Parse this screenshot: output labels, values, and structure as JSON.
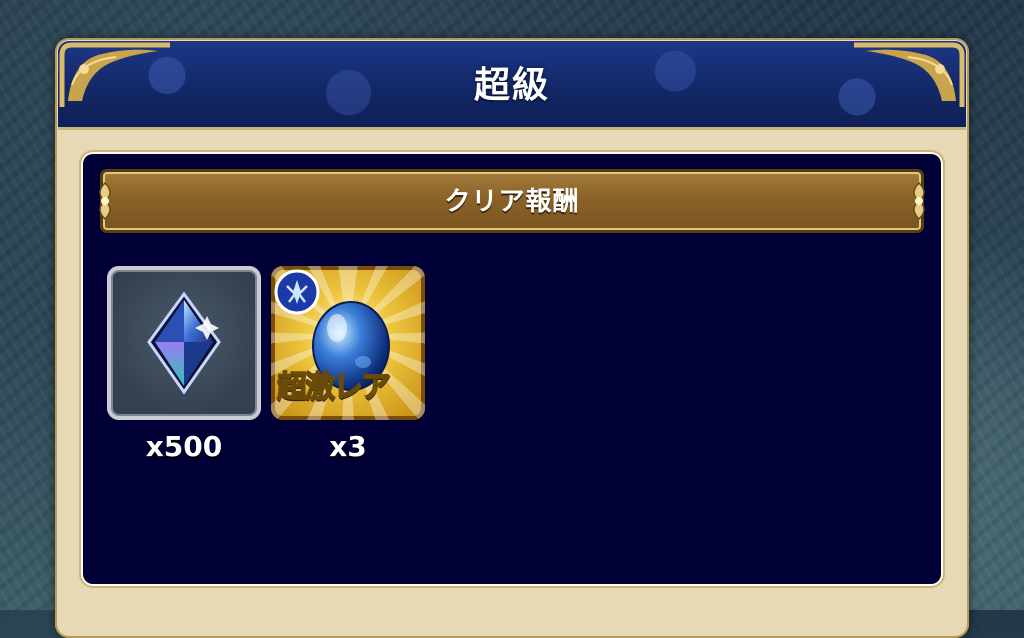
{
  "header": {
    "title": "超級"
  },
  "section": {
    "title": "クリア報酬"
  },
  "rewards": [
    {
      "name": "crystal",
      "quantity": "x500"
    },
    {
      "name": "egg",
      "badge": "超激レア",
      "quantity": "x3"
    }
  ],
  "colors": {
    "header_blue": "#132766",
    "content_navy": "#000036",
    "banner_brown": "#8a6228",
    "gold": "#c9b47b"
  }
}
